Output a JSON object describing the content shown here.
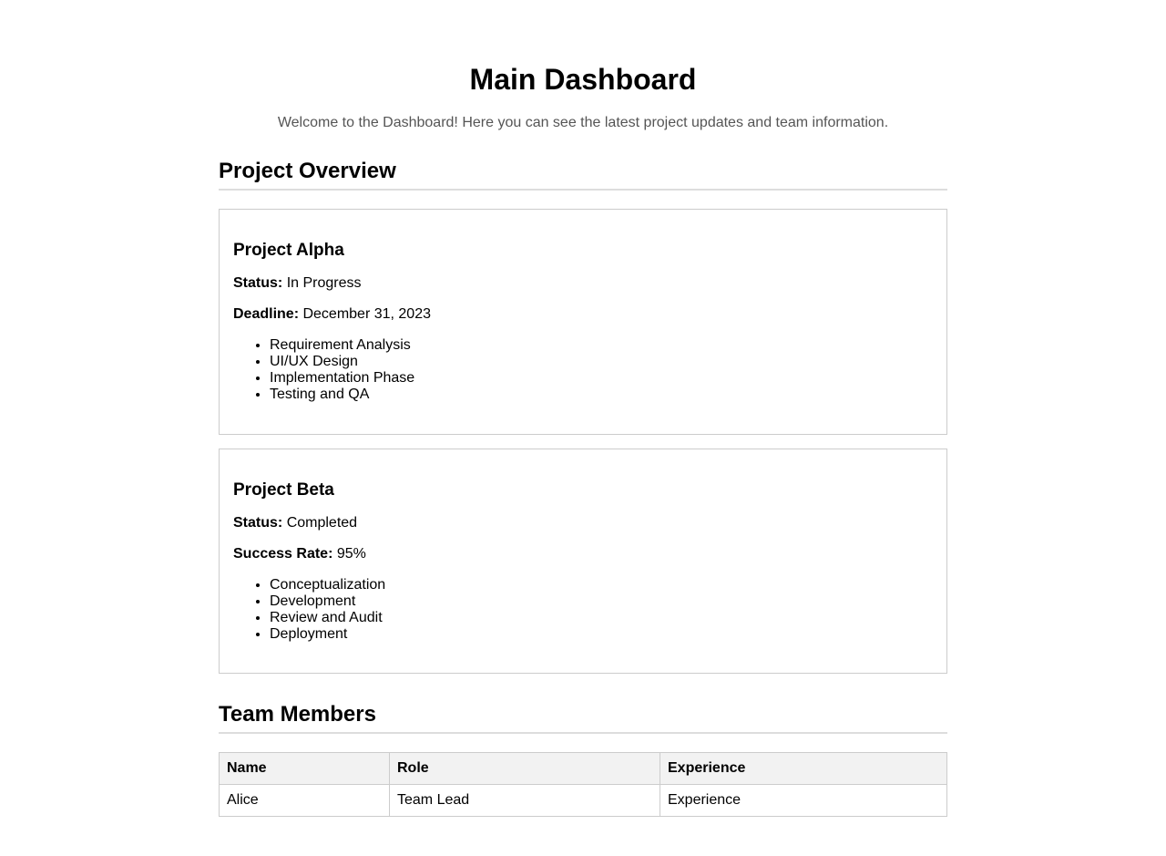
{
  "page": {
    "title": "Main Dashboard",
    "welcome": "Welcome to the Dashboard! Here you can see the latest project updates and team information."
  },
  "overview": {
    "heading": "Project Overview",
    "projects": [
      {
        "name": "Project Alpha",
        "fields": [
          {
            "label": "Status:",
            "value": "In Progress"
          },
          {
            "label": "Deadline:",
            "value": "December 31, 2023"
          }
        ],
        "steps": [
          "Requirement Analysis",
          "UI/UX Design",
          "Implementation Phase",
          "Testing and QA"
        ]
      },
      {
        "name": "Project Beta",
        "fields": [
          {
            "label": "Status:",
            "value": "Completed"
          },
          {
            "label": "Success Rate:",
            "value": "95%"
          }
        ],
        "steps": [
          "Conceptualization",
          "Development",
          "Review and Audit",
          "Deployment"
        ]
      }
    ]
  },
  "team": {
    "heading": "Team Members",
    "columns": [
      "Name",
      "Role",
      "Experience"
    ],
    "rows": [
      [
        "Alice",
        "Team Lead",
        "Experience"
      ]
    ]
  }
}
